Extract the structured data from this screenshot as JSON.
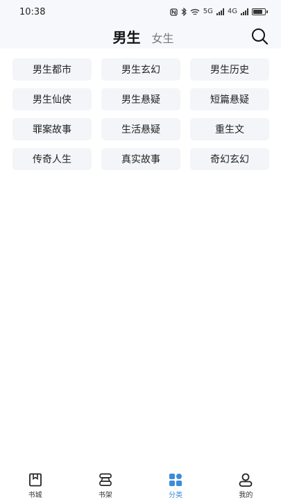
{
  "status_bar": {
    "time": "10:38",
    "net_5g": "5G",
    "net_4g": "4G"
  },
  "header": {
    "tab_male": "男生",
    "tab_female": "女生"
  },
  "categories": [
    "男生都市",
    "男生玄幻",
    "男生历史",
    "男生仙侠",
    "男生悬疑",
    "短篇悬疑",
    "罪案故事",
    "生活悬疑",
    "重生文",
    "传奇人生",
    "真实故事",
    "奇幻玄幻"
  ],
  "bottom_nav": {
    "items": [
      {
        "label": "书城",
        "icon": "bookstore-icon"
      },
      {
        "label": "书架",
        "icon": "bookshelf-icon"
      },
      {
        "label": "分类",
        "icon": "category-icon"
      },
      {
        "label": "我的",
        "icon": "profile-icon"
      }
    ],
    "active_index": 2
  },
  "colors": {
    "accent": "#3d8bd9",
    "chip_bg": "#f3f5f8",
    "header_bg": "#f6f8fb"
  }
}
